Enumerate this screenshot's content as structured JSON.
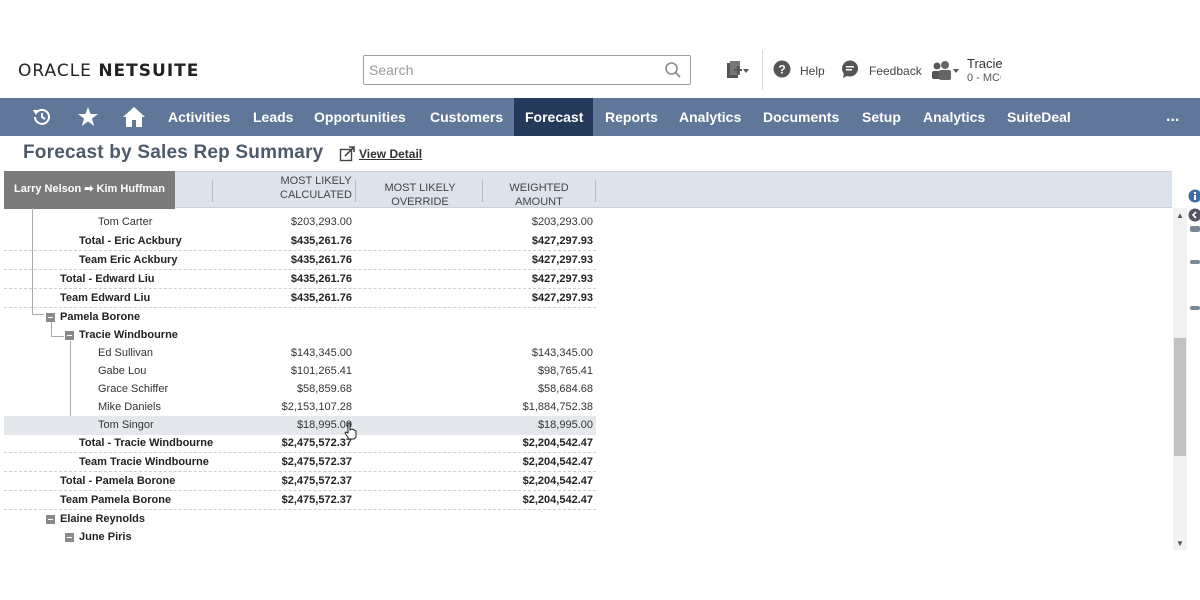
{
  "header": {
    "logo_oracle": "ORACLE",
    "logo_netsuite": "NETSUITE",
    "search_placeholder": "Search",
    "help_label": "Help",
    "feedback_label": "Feedback",
    "user_name": "Tracie",
    "user_role": "0 - MCC"
  },
  "nav": {
    "items": [
      "Activities",
      "Leads",
      "Opportunities",
      "Customers",
      "Forecast",
      "Reports",
      "Analytics",
      "Documents",
      "Setup",
      "Analytics",
      "SuiteDeal"
    ],
    "active": "Forecast",
    "more": "..."
  },
  "page": {
    "title": "Forecast by Sales Rep Summary",
    "view_detail": "View Detail"
  },
  "grid": {
    "breadcrumb": "Larry Nelson ➡ Kim Huffman",
    "columns": {
      "most_likely_calculated": "MOST LIKELY CALCULATED",
      "most_likely_override": "MOST LIKELY OVERRIDE",
      "weighted_amount": "WEIGHTED AMOUNT"
    },
    "rows": [
      {
        "name": "Tom Carter",
        "calc": "$203,293.00",
        "weighted": "$203,293.00"
      },
      {
        "name": "Total - Eric Ackbury",
        "calc": "$435,261.76",
        "weighted": "$427,297.93"
      },
      {
        "name": "Team Eric Ackbury",
        "calc": "$435,261.76",
        "weighted": "$427,297.93"
      },
      {
        "name": "Total - Edward Liu",
        "calc": "$435,261.76",
        "weighted": "$427,297.93"
      },
      {
        "name": "Team Edward Liu",
        "calc": "$435,261.76",
        "weighted": "$427,297.93"
      },
      {
        "name": "Pamela Borone",
        "calc": "",
        "weighted": ""
      },
      {
        "name": "Tracie Windbourne",
        "calc": "",
        "weighted": ""
      },
      {
        "name": "Ed Sullivan",
        "calc": "$143,345.00",
        "weighted": "$143,345.00"
      },
      {
        "name": "Gabe Lou",
        "calc": "$101,265.41",
        "weighted": "$98,765.41"
      },
      {
        "name": "Grace Schiffer",
        "calc": "$58,859.68",
        "weighted": "$58,684.68"
      },
      {
        "name": "Mike Daniels",
        "calc": "$2,153,107.28",
        "weighted": "$1,884,752.38"
      },
      {
        "name": "Tom Singor",
        "calc": "$18,995.00",
        "weighted": "$18,995.00"
      },
      {
        "name": "Total - Tracie Windbourne",
        "calc": "$2,475,572.37",
        "weighted": "$2,204,542.47"
      },
      {
        "name": "Team Tracie Windbourne",
        "calc": "$2,475,572.37",
        "weighted": "$2,204,542.47"
      },
      {
        "name": "Total - Pamela Borone",
        "calc": "$2,475,572.37",
        "weighted": "$2,204,542.47"
      },
      {
        "name": "Team Pamela Borone",
        "calc": "$2,475,572.37",
        "weighted": "$2,204,542.47"
      },
      {
        "name": "Elaine Reynolds",
        "calc": "",
        "weighted": ""
      },
      {
        "name": "June Piris",
        "calc": "",
        "weighted": ""
      }
    ]
  },
  "colors": {
    "nav_bg": "#607799",
    "nav_active": "#253a5a",
    "title": "#4d5a6a"
  }
}
